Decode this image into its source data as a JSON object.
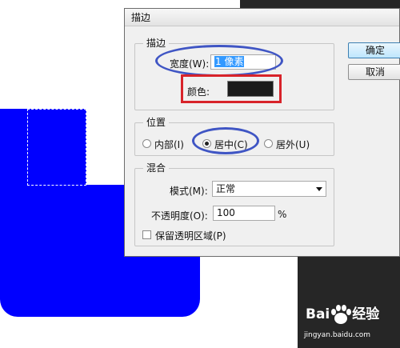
{
  "dialog": {
    "title": "描边",
    "ok_label": "确定",
    "cancel_label": "取消",
    "stroke": {
      "group_title": "描边",
      "width_label": "宽度(W):",
      "width_value": "1 像素",
      "color_label": "颜色:",
      "color_value": "#1b1b1b"
    },
    "position": {
      "group_title": "位置",
      "inside_label": "内部(I)",
      "center_label": "居中(C)",
      "outside_label": "居外(U)",
      "selected": "center"
    },
    "blend": {
      "group_title": "混合",
      "mode_label": "模式(M):",
      "mode_value": "正常",
      "opacity_label": "不透明度(O):",
      "opacity_value": "100",
      "opacity_unit": "%",
      "preserve_label": "保留透明区域(P)",
      "preserve_checked": false
    }
  },
  "canvas": {
    "fill_color": "#0000ff",
    "background_dark": "#262626"
  },
  "watermark": {
    "brand": "Bai",
    "brand_tail": "经验",
    "url": "jingyan.baidu.com"
  },
  "annotations": {
    "ring_color": "#3f55c4",
    "box_color": "#d8232a"
  }
}
